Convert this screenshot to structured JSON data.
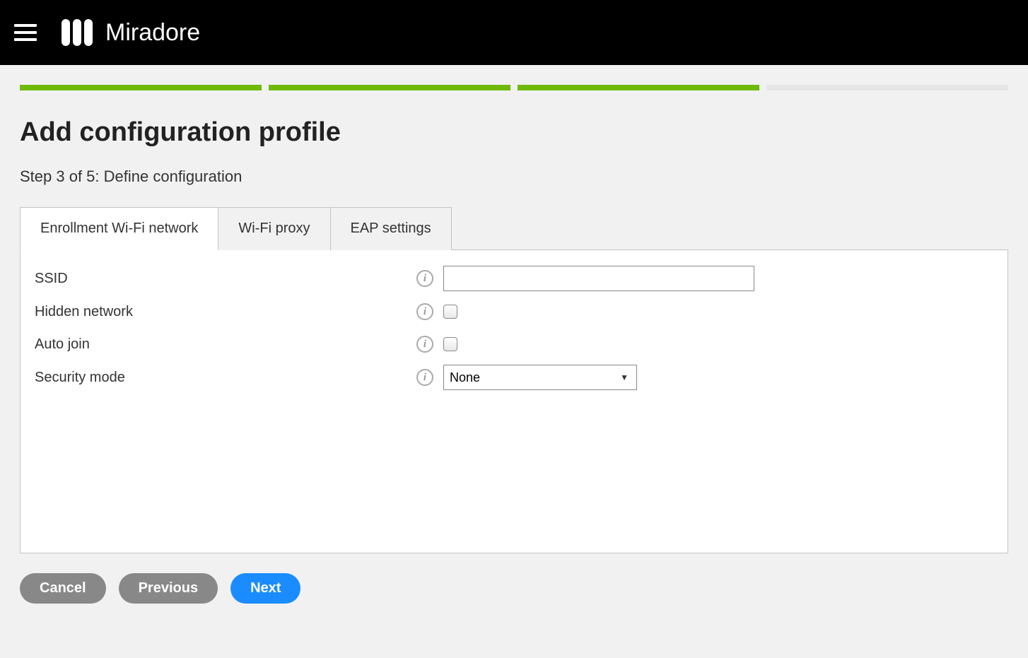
{
  "header": {
    "brand": "Miradore"
  },
  "progress": {
    "total_steps": 5,
    "completed": 3
  },
  "page": {
    "title": "Add configuration profile",
    "step_text": "Step 3 of 5: Define configuration"
  },
  "tabs": [
    {
      "label": "Enrollment Wi-Fi network",
      "active": true
    },
    {
      "label": "Wi-Fi proxy",
      "active": false
    },
    {
      "label": "EAP settings",
      "active": false
    }
  ],
  "form": {
    "ssid": {
      "label": "SSID",
      "value": ""
    },
    "hidden_network": {
      "label": "Hidden network",
      "checked": false
    },
    "auto_join": {
      "label": "Auto join",
      "checked": false
    },
    "security_mode": {
      "label": "Security mode",
      "value": "None"
    }
  },
  "buttons": {
    "cancel": "Cancel",
    "previous": "Previous",
    "next": "Next"
  }
}
